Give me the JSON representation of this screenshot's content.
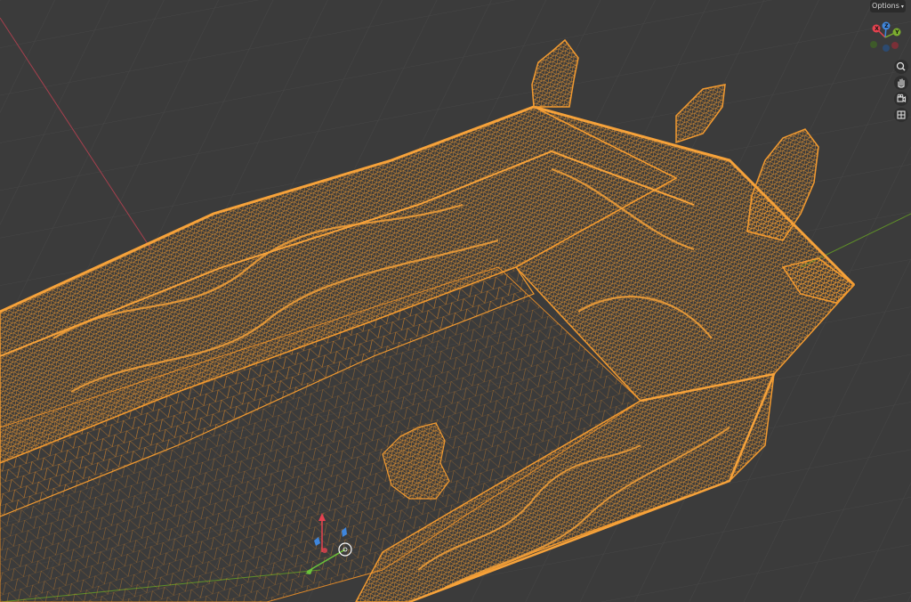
{
  "header": {
    "options_label": "Options"
  },
  "navigation_gizmo": {
    "x_label": "X",
    "y_label": "Y",
    "z_label": "Z",
    "x_color": "#e5424f",
    "y_color": "#7cae2f",
    "z_color": "#3f86dc",
    "neg_y_color": "#3e5a2a",
    "neg_x_color": "#7a3037",
    "neg_z_color": "#2c4a70"
  },
  "view_buttons": [
    {
      "name": "zoom-icon",
      "glyph": "🔍"
    },
    {
      "name": "pan-hand-icon",
      "glyph": "✋"
    },
    {
      "name": "camera-view-icon",
      "glyph": "🎥"
    },
    {
      "name": "ortho-grid-icon",
      "glyph": "▦"
    }
  ],
  "theme": {
    "background": "#3b3b3b",
    "grid_line": "#4a4a4a",
    "wireframe_color": "#f0962a",
    "x_axis_color": "#b04252",
    "y_axis_color": "#6a9a2a"
  }
}
